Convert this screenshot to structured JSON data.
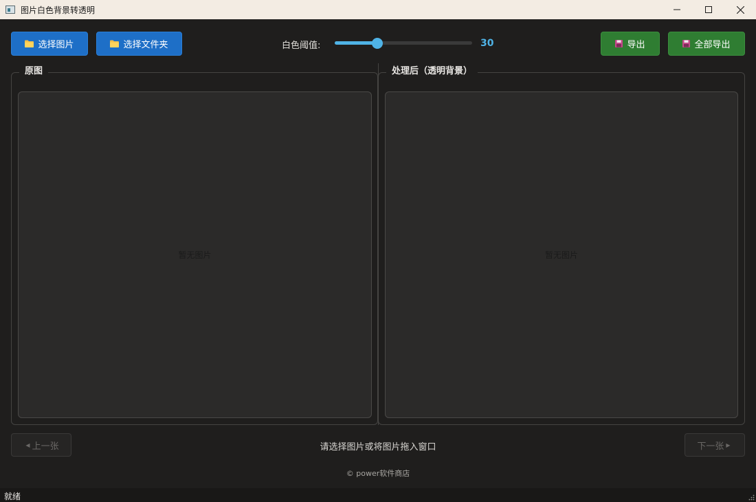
{
  "window": {
    "title": "图片白色背景转透明"
  },
  "toolbar": {
    "select_image_label": "选择图片",
    "select_folder_label": "选择文件夹",
    "threshold_label": "白色阈值:",
    "threshold_value": "30",
    "threshold_fraction": 0.31,
    "export_label": "导出",
    "export_all_label": "全部导出"
  },
  "panels": {
    "original_title": "原图",
    "processed_title": "处理后（透明背景）",
    "original_placeholder": "暂无图片",
    "processed_placeholder": "暂无图片"
  },
  "navigation": {
    "prev_label": "上一张",
    "next_label": "下一张",
    "message": "请选择图片或将图片拖入窗口"
  },
  "footer": {
    "copyright": "© power软件商店"
  },
  "statusbar": {
    "status": "就绪"
  },
  "colors": {
    "accent_blue": "#1e6fc7",
    "accent_green": "#2f7d32",
    "slider": "#4fb3e6",
    "background": "#1f1e1d"
  },
  "icons": {
    "folder": "folder-icon",
    "save": "floppy-disk-icon"
  }
}
